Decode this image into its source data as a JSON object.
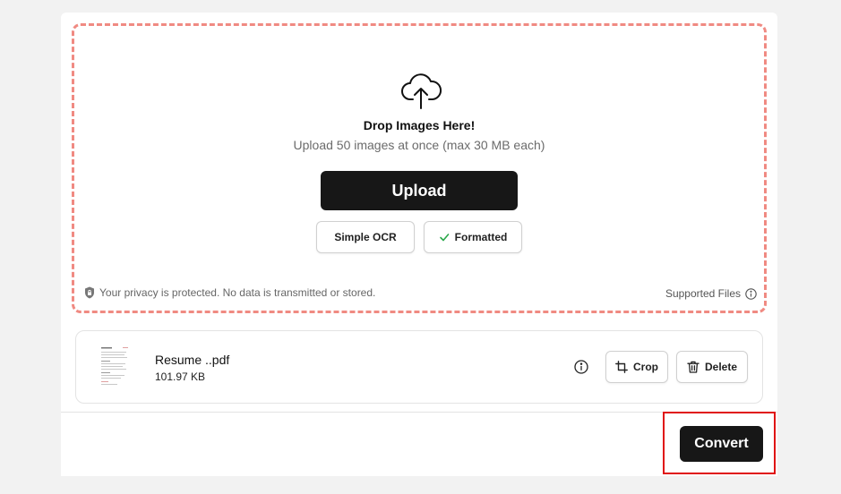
{
  "dropzone": {
    "title": "Drop Images Here!",
    "subtitle": "Upload 50 images at once (max 30 MB each)",
    "upload_label": "Upload",
    "modes": [
      {
        "label": "Simple OCR",
        "selected": false
      },
      {
        "label": "Formatted",
        "selected": true
      }
    ],
    "privacy_text": "Your privacy is protected. No data is transmitted or stored.",
    "supported_label": "Supported Files",
    "border_color": "#f08a82"
  },
  "file": {
    "name": "Resume ..pdf",
    "size": "101.97 KB",
    "crop_label": "Crop",
    "delete_label": "Delete"
  },
  "footer": {
    "convert_label": "Convert",
    "highlight_color": "#e01010"
  },
  "icons": [
    "cloud-upload-icon",
    "check-icon",
    "lock-icon",
    "info-icon",
    "crop-icon",
    "trash-icon"
  ]
}
